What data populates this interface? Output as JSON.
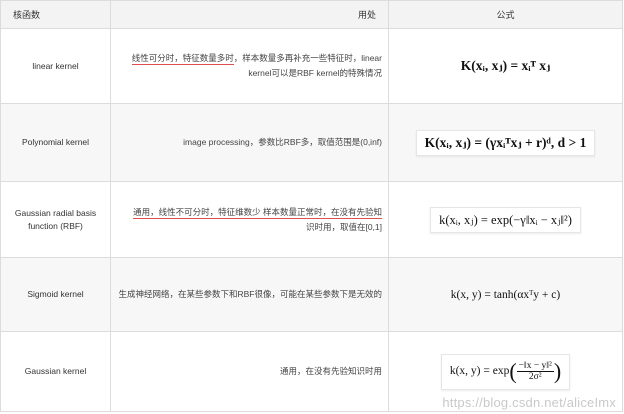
{
  "headers": {
    "name": "核函数",
    "use": "用处",
    "formula": "公式"
  },
  "rows": [
    {
      "name": "linear kernel",
      "use_hl": "线性可分时，特征数量多时",
      "use_rest": "，样本数量多再补充一些特征时，linear kernel可以是RBF kernel的特殊情况",
      "formula": "K(xᵢ, xⱼ) = xᵢᵀ xⱼ"
    },
    {
      "name": "Polynomial kernel",
      "use_hl": "",
      "use_rest": "image processing，参数比RBF多，取值范围是(0,inf)",
      "formula": "K(xᵢ, xⱼ) = (γxᵢᵀxⱼ + r)ᵈ, d > 1"
    },
    {
      "name": "Gaussian radial basis function (RBF)",
      "use_hl": "通用，线性不可分时，特征维数少 样本数量正常时，在没有先验知",
      "use_rest": "识时用，取值在[0,1]",
      "formula": "k(xᵢ, xⱼ) = exp(−γ‖xᵢ − xⱼ‖²)"
    },
    {
      "name": "Sigmoid kernel",
      "use_hl": "",
      "use_rest": "生成神经网络，在某些参数下和RBF很像，可能在某些参数下是无效的",
      "formula": "k(x, y) = tanh(αxᵀy + c)"
    },
    {
      "name": "Gaussian kernel",
      "use_hl": "",
      "use_rest": "通用，在没有先验知识时用",
      "formula_lead": "k(x, y) = exp",
      "formula_num": "−‖x − y‖²",
      "formula_den": "2σ²"
    }
  ],
  "watermark": "https://blog.csdn.net/aliceImx"
}
